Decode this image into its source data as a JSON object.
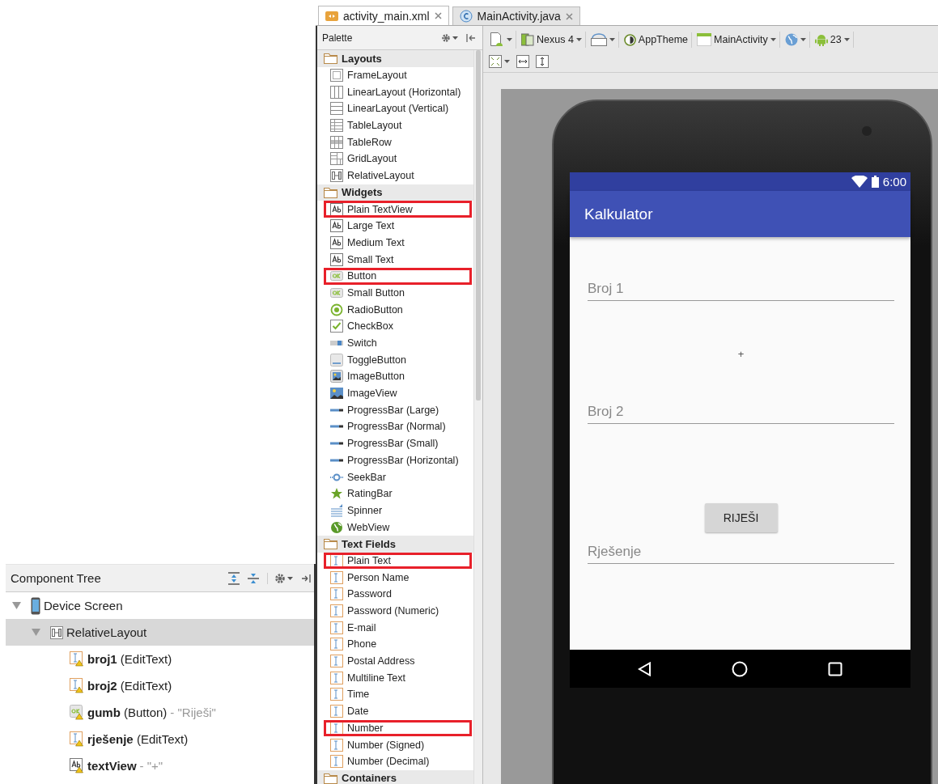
{
  "tabs": [
    {
      "label": "activity_main.xml",
      "kind": "xml",
      "selected": true
    },
    {
      "label": "MainActivity.java",
      "kind": "java",
      "selected": false
    }
  ],
  "palette": {
    "title": "Palette",
    "categories": [
      {
        "label": "Layouts",
        "items": [
          {
            "label": "FrameLayout",
            "kind": "frame",
            "highlighted": false
          },
          {
            "label": "LinearLayout (Horizontal)",
            "kind": "linear-h",
            "highlighted": false
          },
          {
            "label": "LinearLayout (Vertical)",
            "kind": "linear-v",
            "highlighted": false
          },
          {
            "label": "TableLayout",
            "kind": "table",
            "highlighted": false
          },
          {
            "label": "TableRow",
            "kind": "table-row",
            "highlighted": false
          },
          {
            "label": "GridLayout",
            "kind": "grid",
            "highlighted": false
          },
          {
            "label": "RelativeLayout",
            "kind": "relative",
            "highlighted": false
          }
        ]
      },
      {
        "label": "Widgets",
        "items": [
          {
            "label": "Plain TextView",
            "kind": "text",
            "highlighted": true
          },
          {
            "label": "Large Text",
            "kind": "text",
            "highlighted": false
          },
          {
            "label": "Medium Text",
            "kind": "text",
            "highlighted": false
          },
          {
            "label": "Small Text",
            "kind": "text",
            "highlighted": false
          },
          {
            "label": "Button",
            "kind": "button",
            "highlighted": true
          },
          {
            "label": "Small Button",
            "kind": "button",
            "highlighted": false
          },
          {
            "label": "RadioButton",
            "kind": "radio",
            "highlighted": false
          },
          {
            "label": "CheckBox",
            "kind": "check",
            "highlighted": false
          },
          {
            "label": "Switch",
            "kind": "switch",
            "highlighted": false
          },
          {
            "label": "ToggleButton",
            "kind": "toggle",
            "highlighted": false
          },
          {
            "label": "ImageButton",
            "kind": "image-button",
            "highlighted": false
          },
          {
            "label": "ImageView",
            "kind": "image",
            "highlighted": false
          },
          {
            "label": "ProgressBar (Large)",
            "kind": "progress",
            "highlighted": false
          },
          {
            "label": "ProgressBar (Normal)",
            "kind": "progress",
            "highlighted": false
          },
          {
            "label": "ProgressBar (Small)",
            "kind": "progress",
            "highlighted": false
          },
          {
            "label": "ProgressBar (Horizontal)",
            "kind": "progress",
            "highlighted": false
          },
          {
            "label": "SeekBar",
            "kind": "seek",
            "highlighted": false
          },
          {
            "label": "RatingBar",
            "kind": "rating",
            "highlighted": false
          },
          {
            "label": "Spinner",
            "kind": "spinner",
            "highlighted": false
          },
          {
            "label": "WebView",
            "kind": "web",
            "highlighted": false
          }
        ]
      },
      {
        "label": "Text Fields",
        "items": [
          {
            "label": "Plain Text",
            "kind": "field",
            "highlighted": true
          },
          {
            "label": "Person Name",
            "kind": "field",
            "highlighted": false
          },
          {
            "label": "Password",
            "kind": "field",
            "highlighted": false
          },
          {
            "label": "Password (Numeric)",
            "kind": "field",
            "highlighted": false
          },
          {
            "label": "E-mail",
            "kind": "field",
            "highlighted": false
          },
          {
            "label": "Phone",
            "kind": "field",
            "highlighted": false
          },
          {
            "label": "Postal Address",
            "kind": "field",
            "highlighted": false
          },
          {
            "label": "Multiline Text",
            "kind": "field",
            "highlighted": false
          },
          {
            "label": "Time",
            "kind": "field",
            "highlighted": false
          },
          {
            "label": "Date",
            "kind": "field",
            "highlighted": false
          },
          {
            "label": "Number",
            "kind": "field",
            "highlighted": true
          },
          {
            "label": "Number (Signed)",
            "kind": "field",
            "highlighted": false
          },
          {
            "label": "Number (Decimal)",
            "kind": "field",
            "highlighted": false
          }
        ]
      },
      {
        "label": "Containers"
      }
    ]
  },
  "toolbar": {
    "rows": [
      [
        {
          "kind": "device",
          "dropdown": true
        },
        {
          "kind": "nexus",
          "label": "Nexus 4",
          "dropdown": true
        },
        {
          "kind": "orientation",
          "dropdown": true
        },
        {
          "kind": "theme",
          "label": "AppTheme",
          "dropdown": false
        },
        {
          "kind": "activity",
          "label": "MainActivity",
          "dropdown": true
        },
        {
          "kind": "locale",
          "dropdown": true
        },
        {
          "kind": "api",
          "label": "23",
          "dropdown": true
        }
      ],
      [
        {
          "kind": "zoom",
          "dropdown": true
        },
        {
          "kind": "fit-width",
          "dropdown": false
        },
        {
          "kind": "fit-height",
          "dropdown": false
        }
      ]
    ]
  },
  "component_tree": {
    "title": "Component Tree",
    "nodes": [
      {
        "label": "Device Screen",
        "kind": "device",
        "expanded": true,
        "selected": false,
        "children": [
          {
            "label": "RelativeLayout",
            "kind": "relative",
            "expanded": true,
            "selected": true,
            "children": [
              {
                "label": "**broj1** (EditText)",
                "kind": "field",
                "selected": false,
                "warning": true
              },
              {
                "label": "**broj2** (EditText)",
                "kind": "field",
                "selected": false,
                "warning": true
              },
              {
                "label": "**gumb** (Button)",
                "value": "- \"Riješi\"",
                "kind": "button",
                "selected": false,
                "warning": true
              },
              {
                "label": "**rješenje** (EditText)",
                "kind": "field",
                "selected": false,
                "warning": true
              },
              {
                "label": "**textView**",
                "value": "- \"+\"",
                "kind": "text",
                "selected": false,
                "warning": true
              }
            ]
          }
        ]
      }
    ]
  },
  "phone": {
    "time": "6:00",
    "app_title": "Kalkulator",
    "views": [
      {
        "kind": "edit",
        "placeholder": "Broj 1"
      },
      {
        "kind": "text",
        "text": "+"
      },
      {
        "kind": "edit",
        "placeholder": "Broj 2"
      },
      {
        "kind": "button",
        "text": "RIJEŠI"
      },
      {
        "kind": "edit",
        "placeholder": "Rješenje"
      }
    ]
  }
}
